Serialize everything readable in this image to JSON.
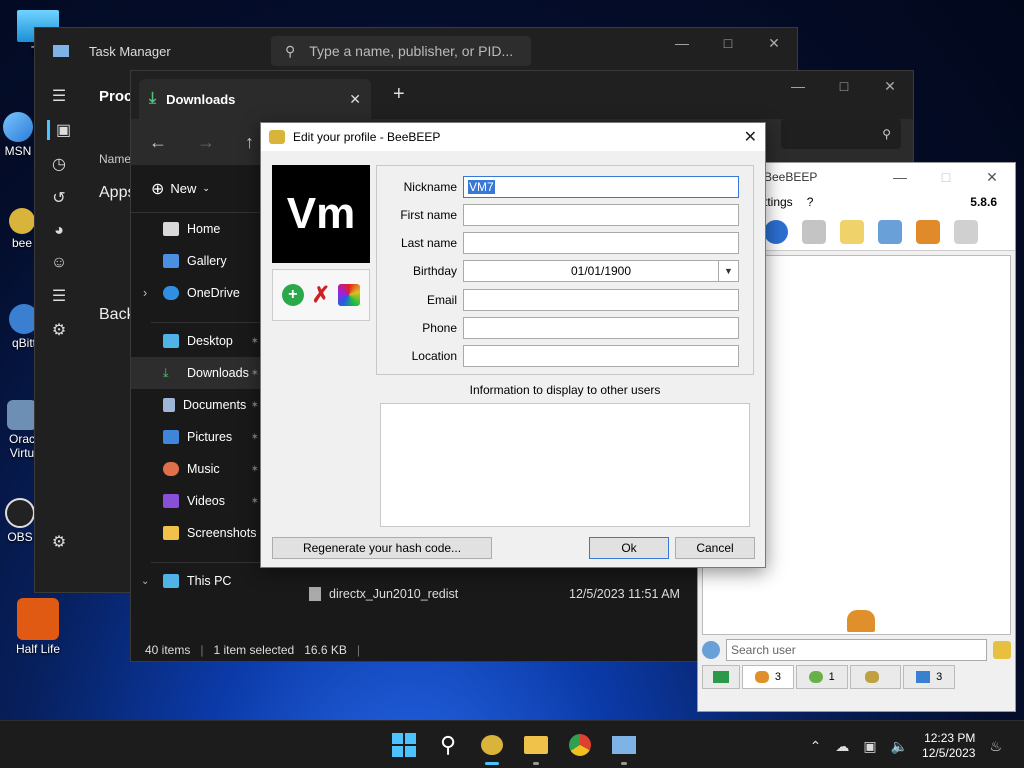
{
  "desktop": {
    "icons": [
      {
        "label": "Th"
      },
      {
        "label": "MSN"
      },
      {
        "label": "bee"
      },
      {
        "label": "qBitt"
      },
      {
        "label": "Orac Virtu"
      },
      {
        "label": "OBS"
      },
      {
        "label": "Half Life"
      }
    ]
  },
  "task_manager": {
    "title": "Task Manager",
    "search_placeholder": "Type a name, publisher, or PID...",
    "heading": "Proce",
    "col_name": "Name",
    "apps_label": "Apps",
    "background_label": "Back"
  },
  "explorer": {
    "tab_title": "Downloads",
    "new_label": "New",
    "sidebar": [
      {
        "label": "Home"
      },
      {
        "label": "Gallery"
      },
      {
        "label": "OneDrive"
      },
      {
        "label": "Desktop"
      },
      {
        "label": "Downloads"
      },
      {
        "label": "Documents"
      },
      {
        "label": "Pictures"
      },
      {
        "label": "Music"
      },
      {
        "label": "Videos"
      },
      {
        "label": "Screenshots"
      },
      {
        "label": "This PC"
      }
    ],
    "file": {
      "name": "directx_Jun2010_redist",
      "date": "12/5/2023 11:51 AM"
    },
    "status": {
      "items": "40 items",
      "selected": "1 item selected",
      "size": "16.6 KB"
    }
  },
  "beebeep": {
    "title": "BeeBEEP",
    "menu": [
      "ttings",
      "?"
    ],
    "version": "5.8.6",
    "search_placeholder": "Search user",
    "tabs": [
      {
        "count": "3"
      },
      {
        "count": "1"
      },
      {
        "count": ""
      },
      {
        "count": "3"
      }
    ]
  },
  "dialog": {
    "title": "Edit your profile - BeeBEEP",
    "avatar_initials": "Vm",
    "fields": {
      "nickname": {
        "label": "Nickname",
        "value": "VM7"
      },
      "first_name": {
        "label": "First name",
        "value": ""
      },
      "last_name": {
        "label": "Last name",
        "value": ""
      },
      "birthday": {
        "label": "Birthday",
        "value": "01/01/1900"
      },
      "email": {
        "label": "Email",
        "value": ""
      },
      "phone": {
        "label": "Phone",
        "value": ""
      },
      "location": {
        "label": "Location",
        "value": ""
      }
    },
    "info_label": "Information to display to other users",
    "regen_button": "Regenerate your hash code...",
    "ok_button": "Ok",
    "cancel_button": "Cancel"
  },
  "taskbar": {
    "time": "12:23 PM",
    "date": "12/5/2023"
  }
}
